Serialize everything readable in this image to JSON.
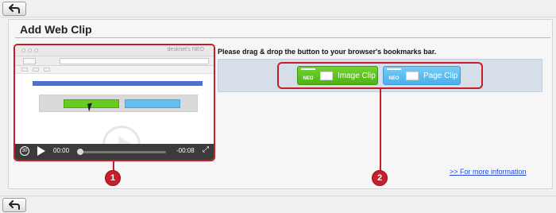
{
  "toolbar": {
    "back_icon": "back-arrow-icon"
  },
  "panel": {
    "title": "Add Web Clip",
    "instruction": "Please drag & drop the button to your browser's bookmarks bar.",
    "more_info_link": ">> For more information"
  },
  "video": {
    "browser_title": "desknet's NEO",
    "start_time": "00:00",
    "end_time": "-00:08",
    "rewind_label": "30",
    "progress": 0
  },
  "buttons": {
    "image_clip": {
      "label": "Image Clip",
      "badge": "NEO"
    },
    "page_clip": {
      "label": "Page Clip",
      "badge": "NEO"
    }
  },
  "callouts": [
    "1",
    "2"
  ],
  "colors": {
    "highlight_red": "#c61f2a",
    "image_clip_green": "#66cc22",
    "page_clip_blue": "#64bff3",
    "link_blue": "#1d48e6"
  }
}
